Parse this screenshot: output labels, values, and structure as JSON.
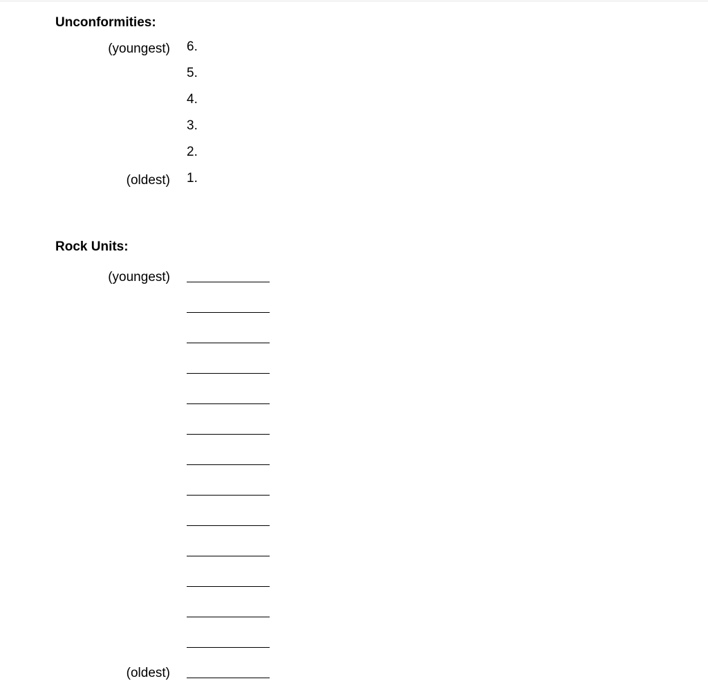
{
  "unconformities": {
    "heading": "Unconformities:",
    "youngest_label": "(youngest)",
    "oldest_label": "(oldest)",
    "items": [
      "6.",
      "5.",
      "4.",
      "3.",
      "2.",
      "1."
    ]
  },
  "rock_units": {
    "heading": "Rock Units:",
    "youngest_label": "(youngest)",
    "oldest_label": "(oldest)",
    "blank_count": 14
  }
}
